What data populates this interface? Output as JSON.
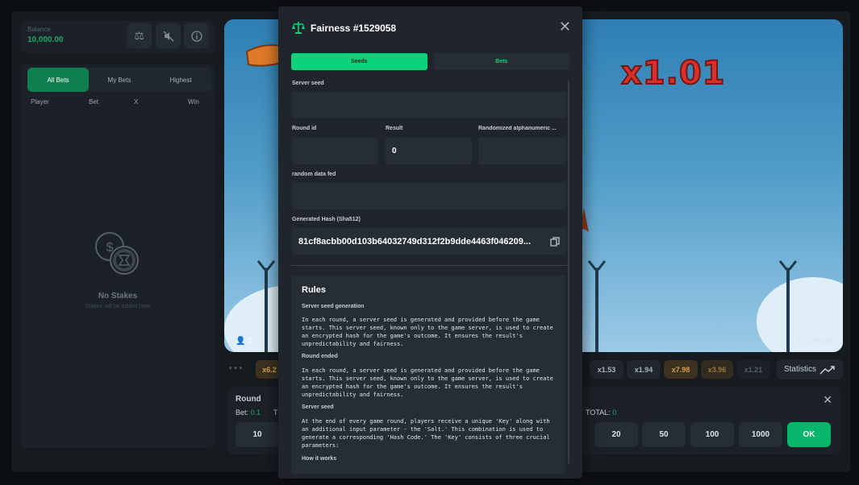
{
  "balance": {
    "label": "Balance",
    "value": "10,000.00"
  },
  "bets": {
    "tabs": [
      "All Bets",
      "My Bets",
      "Highest"
    ],
    "columns": [
      "Player",
      "Bet",
      "X",
      "Win"
    ],
    "empty_title": "No Stakes",
    "empty_sub": "Stakes will be added here"
  },
  "game": {
    "multiplier": "x1.01",
    "round": "#1529058",
    "players": "0"
  },
  "history": [
    "x6.2",
    "x1.53",
    "x1.94",
    "x7.98",
    "x3.96",
    "x1.21"
  ],
  "statistics_label": "Statistics",
  "betpanel": {
    "title": "Round",
    "bet_label": "Bet:",
    "bet_value": "0.1",
    "t_label": "T",
    "total_label": "TOTAL:",
    "total_value": "0",
    "chips": [
      "10",
      "20",
      "50",
      "100",
      "1000"
    ],
    "ok": "OK"
  },
  "modal": {
    "title": "Fairness #1529058",
    "tabs": [
      "Seeds",
      "Bets"
    ],
    "server_seed_label": "Server seed",
    "server_seed": "",
    "round_id_label": "Round id",
    "round_id": "",
    "result_label": "Result",
    "result": "0",
    "random_label": "Randomized alphanumeric ...",
    "random_value": "",
    "random_data_label": "random data fed",
    "random_data": "",
    "hash_label": "Generated Hash (Sha512)",
    "hash": "81cf8acbb00d103b64032749d312f2b9dde4463f046209...",
    "rules": {
      "title": "Rules",
      "s1_title": "Server seed generation",
      "s1_text": "In each round, a server seed is generated and provided before the game starts. This server seed, known only to the game server, is used to create an encrypted hash for the game's outcome. It ensures the result's unpredictability and fairness.",
      "s2_title": "Round ended",
      "s2_text": "In each round, a server seed is generated and provided before the game starts. This server seed, known only to the game server, is used to create an encrypted hash for the game's outcome. It ensures the result's unpredictability and fairness.",
      "s3_title": "Server seed",
      "s3_text": "At the end of every game round, players receive a unique 'Key' along with an additional input parameter - the 'Salt.' This combination is used to generate a corresponding 'Hash Code.' The 'Key' consists of three crucial parameters:",
      "s4_title": "How it works"
    }
  },
  "colors": {
    "accent": "#0bd27b",
    "gold": "#d4a24a",
    "multiplier": "#d9302b"
  }
}
